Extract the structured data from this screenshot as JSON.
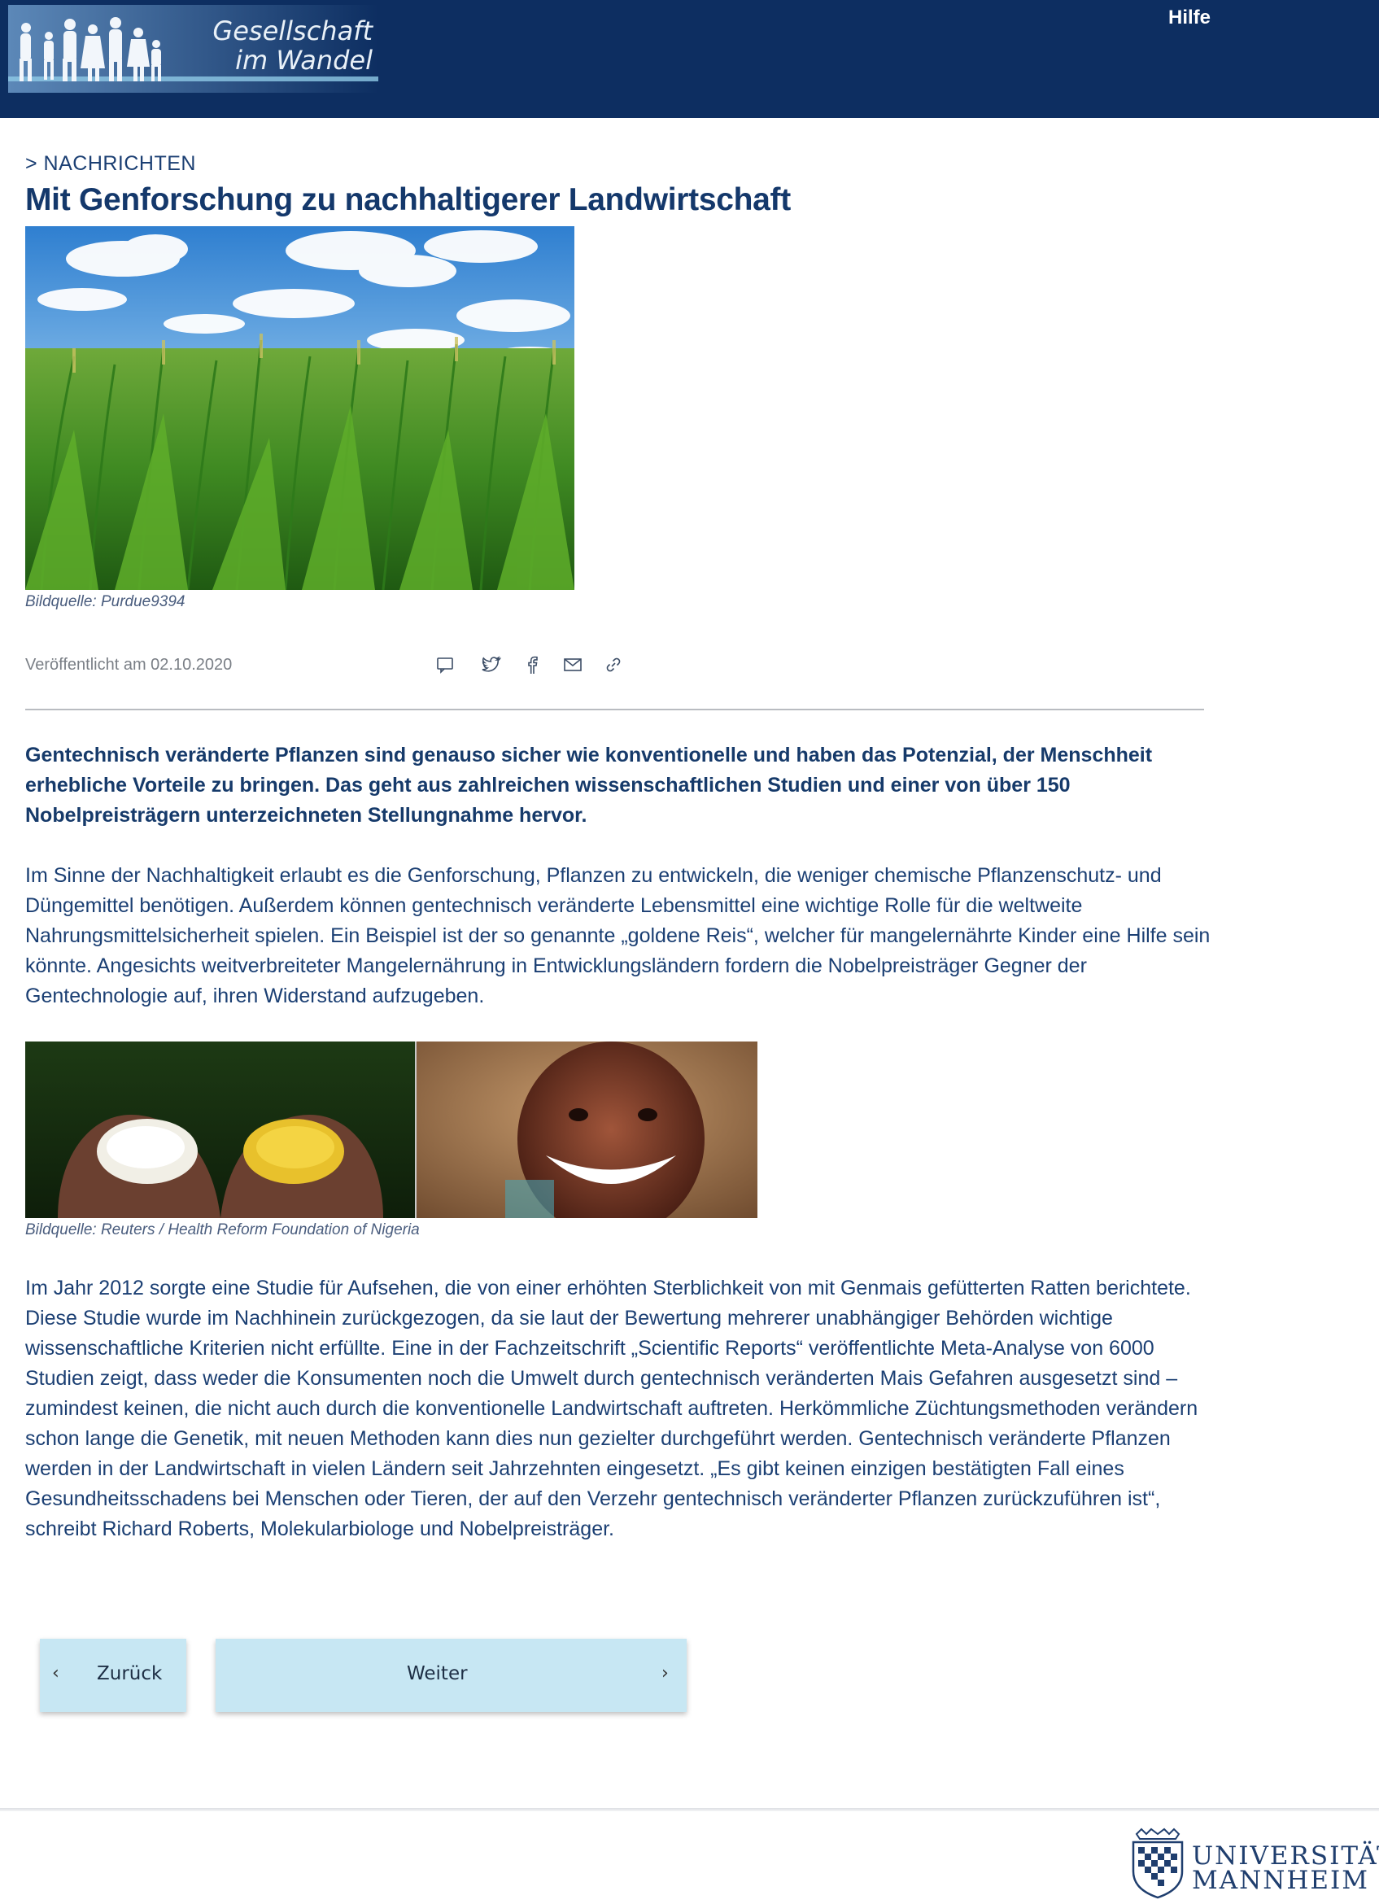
{
  "header": {
    "logo_text_line1": "Gesellschaft",
    "logo_text_line2": "im Wandel",
    "help_label": "Hilfe"
  },
  "article": {
    "breadcrumb": "> NACHRICHTEN",
    "title": "Mit Genforschung zu nachhaltigerer Landwirtschaft",
    "hero_caption": "Bildquelle: Purdue9394",
    "published": "Veröffentlicht am 02.10.2020",
    "share_icons": [
      "comment-icon",
      "twitter-icon",
      "facebook-icon",
      "mail-icon",
      "link-icon"
    ],
    "lead": "Gentechnisch veränderte Pflanzen sind genauso sicher wie konventionelle und haben das Potenzial, der Menschheit erhebliche Vorteile zu bringen. Das geht aus zahlreichen wissenschaftlichen Studien und einer von über 150 Nobelpreisträgern unterzeichneten Stellungnahme hervor.",
    "paragraph1": "Im Sinne der Nachhaltigkeit erlaubt es die Genforschung, Pflanzen zu entwickeln, die weniger chemische Pflanzenschutz- und Düngemittel benötigen. Außerdem können gentechnisch veränderte Lebensmittel eine wichtige Rolle für die weltweite Nahrungsmittelsicherheit spielen. Ein Beispiel ist der so genannte „goldene Reis“, welcher für mangelernährte Kinder eine Hilfe sein könnte. Angesichts weitverbreiteter Mangelernährung in Entwicklungsländern fordern die Nobelpreisträger Gegner der Gentechnologie auf, ihren Widerstand aufzugeben.",
    "image2_caption": "Bildquelle: Reuters / Health Reform Foundation of Nigeria",
    "paragraph2": "Im Jahr 2012 sorgte eine Studie für Aufsehen, die von einer erhöhten Sterblichkeit von mit Genmais gefütterten Ratten berichtete. Diese Studie wurde im Nachhinein zurückgezogen, da sie laut der Bewertung mehrerer unabhängiger Behörden wichtige wissenschaftliche Kriterien nicht erfüllte. Eine in der Fachzeitschrift „Scientific Reports“ veröffentlichte Meta-Analyse von 6000 Studien zeigt, dass weder die Konsumenten noch die Umwelt durch gentechnisch veränderten Mais Gefahren ausgesetzt sind – zumindest keinen, die nicht auch durch die konventionelle Landwirtschaft auftreten. Herkömmliche Züchtungsmethoden verändern schon lange die Genetik, mit neuen Methoden kann dies nun gezielter durchgeführt werden. Gentechnisch veränderte Pflanzen werden in der Landwirtschaft in vielen Ländern seit Jahrzehnten eingesetzt. „Es gibt keinen einzigen bestätigten Fall eines Gesundheitsschadens bei Menschen oder Tieren, der auf den Verzehr gentechnisch veränderter Pflanzen zurückzuführen ist“, schreibt Richard Roberts, Molekularbiologe und Nobelpreisträger."
  },
  "navigation": {
    "back_label": "Zurück",
    "next_label": "Weiter"
  },
  "footer": {
    "university_line1": "UNIVERSITÄT",
    "university_line2": "MANNHEIM"
  },
  "colors": {
    "header_bg": "#0d2e61",
    "text_primary": "#143a6b",
    "button_bg": "#c7e7f3"
  }
}
